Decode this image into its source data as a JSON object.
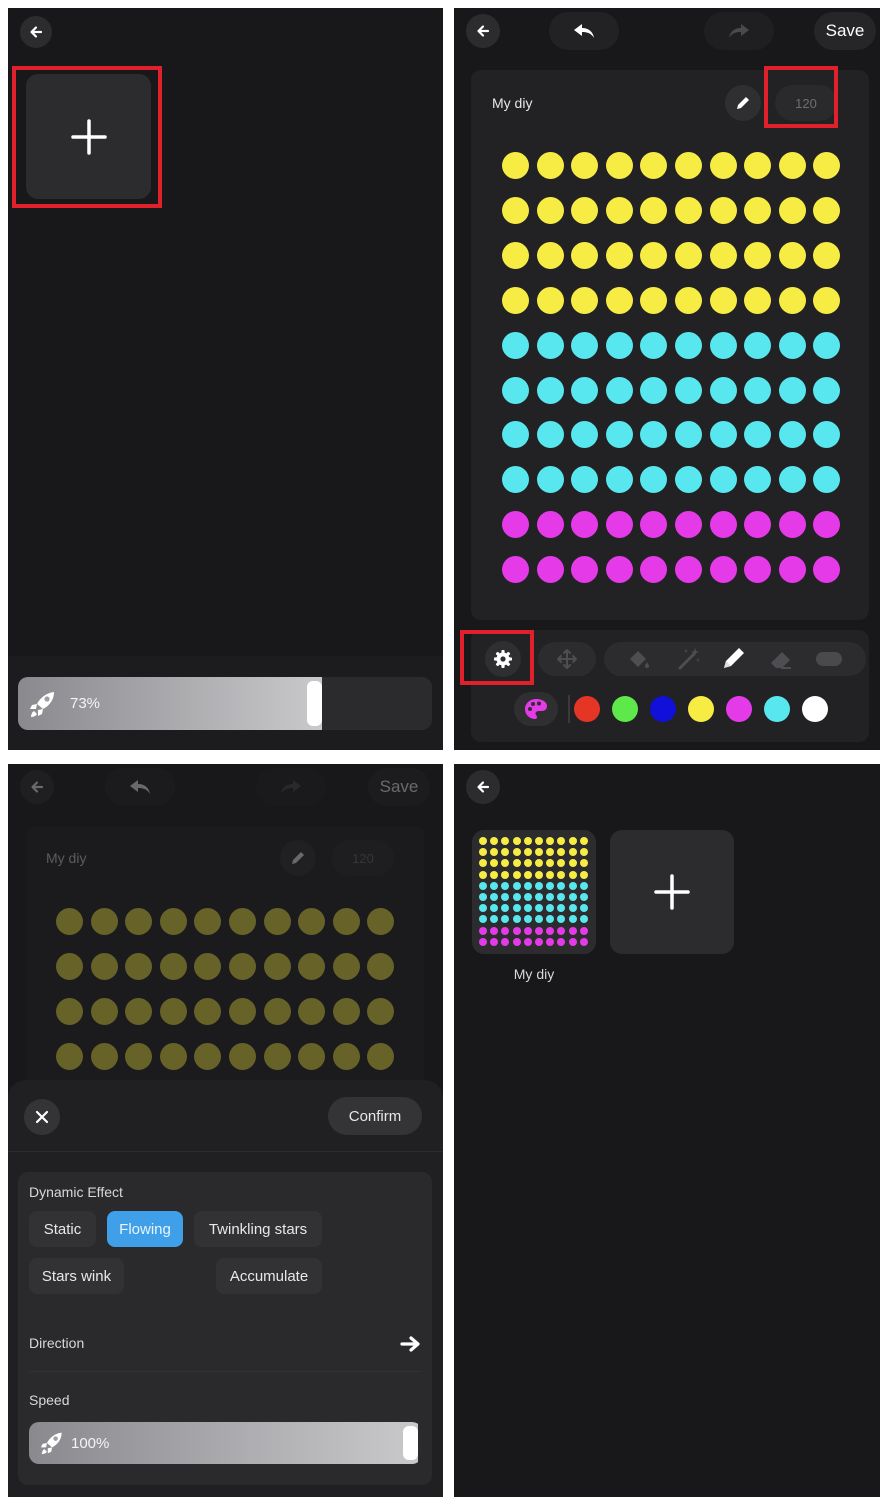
{
  "screen1": {
    "speed_value": "73%",
    "speed_fraction": 0.73,
    "icons": {
      "back": "back-arrow-icon",
      "add": "plus-icon",
      "speed": "rocket-icon"
    }
  },
  "screen2": {
    "save_label": "Save",
    "pattern_name": "My diy",
    "led_count": "120",
    "grid": {
      "columns": 10,
      "row_colors": [
        "yellow",
        "yellow",
        "yellow",
        "yellow",
        "cyan",
        "cyan",
        "cyan",
        "cyan",
        "magenta",
        "magenta"
      ]
    },
    "tools": [
      "settings-icon",
      "move-icon",
      "paint-bucket-icon",
      "magic-wand-icon",
      "pencil-icon",
      "eraser-icon",
      "toggle"
    ],
    "palette_colors": [
      "#e53524",
      "#5fe84a",
      "#1010d8",
      "#f7ec43",
      "#e53ae8",
      "#58e7ee",
      "#ffffff"
    ],
    "colors": {
      "yellow": "#f7ec43",
      "cyan": "#58e7ee",
      "magenta": "#e53ae8"
    }
  },
  "screen3": {
    "save_label": "Save",
    "pattern_name": "My diy",
    "led_count": "120",
    "confirm_label": "Confirm",
    "dynamic_effect_label": "Dynamic Effect",
    "effects": [
      "Static",
      "Flowing",
      "Twinkling stars",
      "Stars wink",
      "Accumulate"
    ],
    "selected_effect": "Flowing",
    "direction_label": "Direction",
    "speed_label": "Speed",
    "speed_value": "100%",
    "speed_fraction": 1.0,
    "accent": "#3f9fe8"
  },
  "screen4": {
    "items": [
      {
        "name": "My diy"
      }
    ]
  }
}
